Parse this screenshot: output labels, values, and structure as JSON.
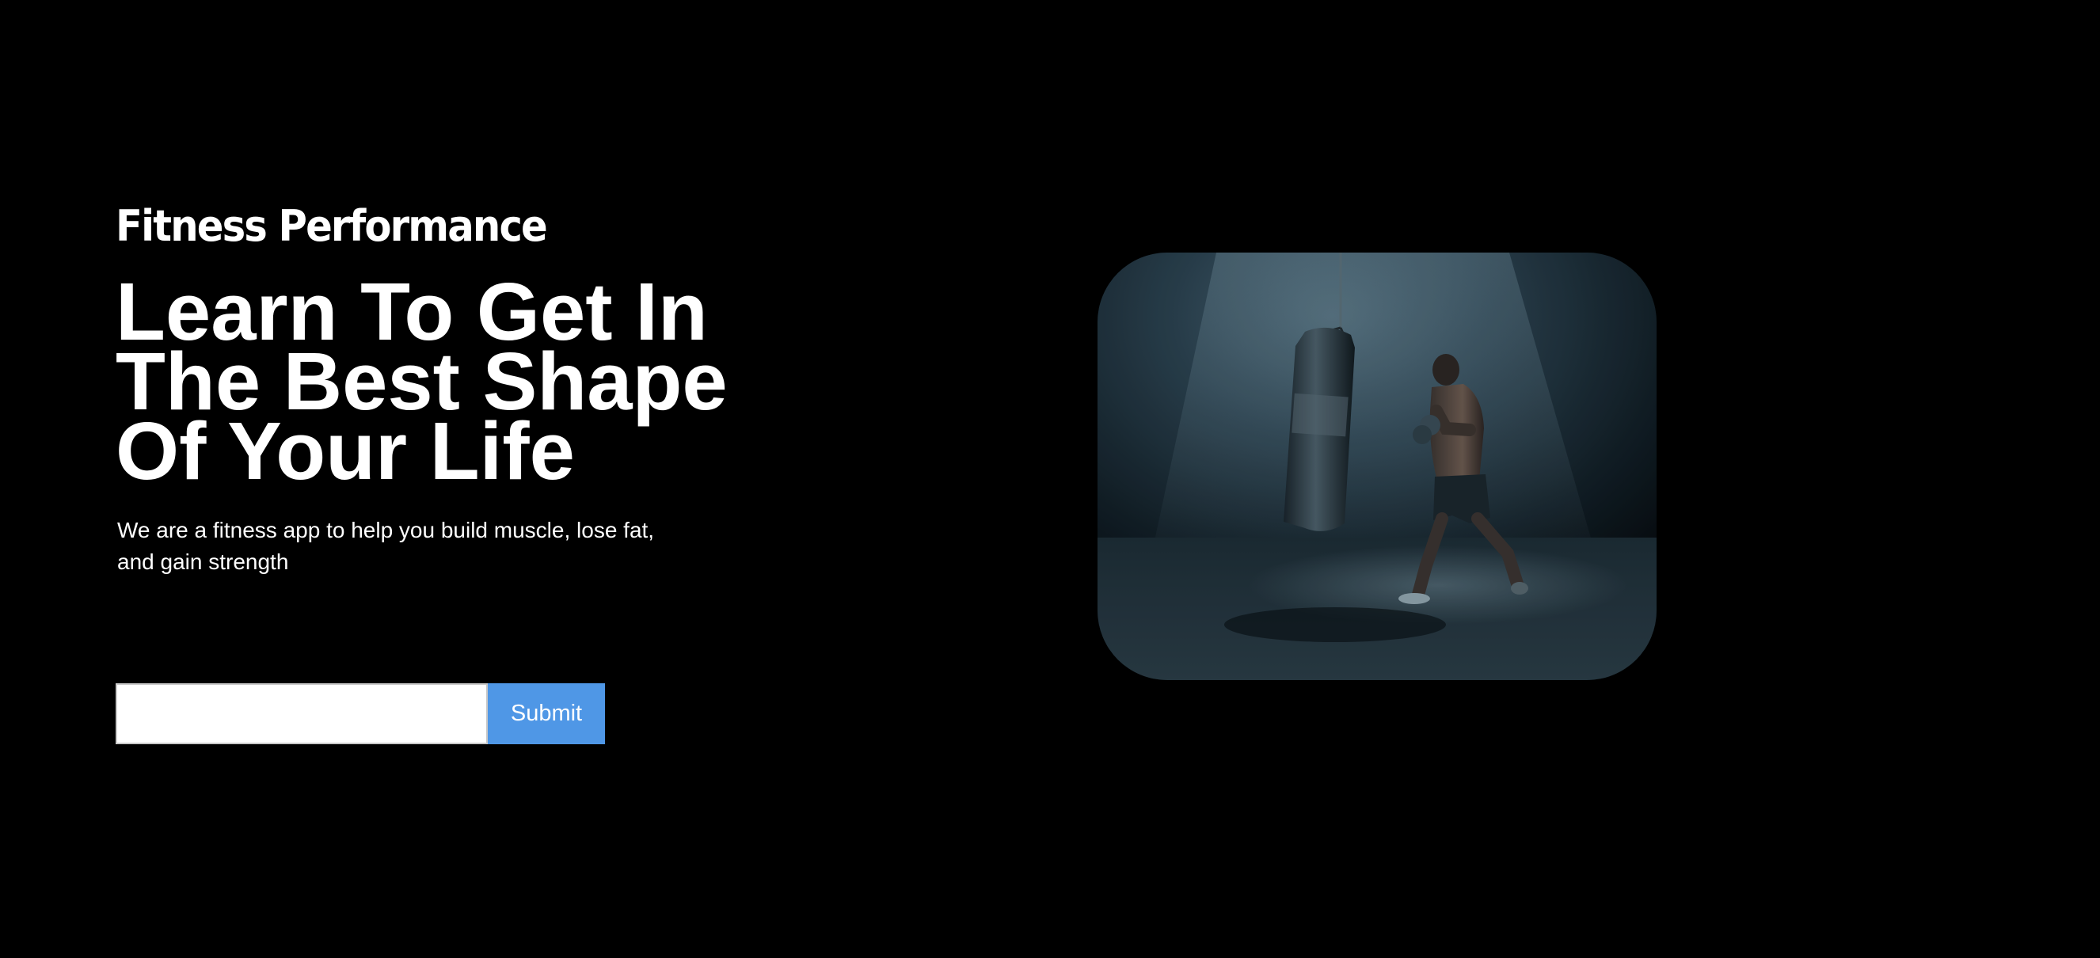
{
  "brand": {
    "name": "Fitness Performance"
  },
  "hero": {
    "headline_lines": [
      "Learn To Get In",
      "The Best Shape",
      "Of Your Life"
    ],
    "description": "We are a fitness app to help you build muscle, lose fat, and gain strength"
  },
  "signup": {
    "input_value": "",
    "input_placeholder": "",
    "submit_label": "Submit"
  },
  "image": {
    "subject": "boxer-training-with-punching-bag",
    "colors": {
      "background": "#000000",
      "accent": "#4f97e6",
      "photo_tint": "#2b4250"
    }
  }
}
